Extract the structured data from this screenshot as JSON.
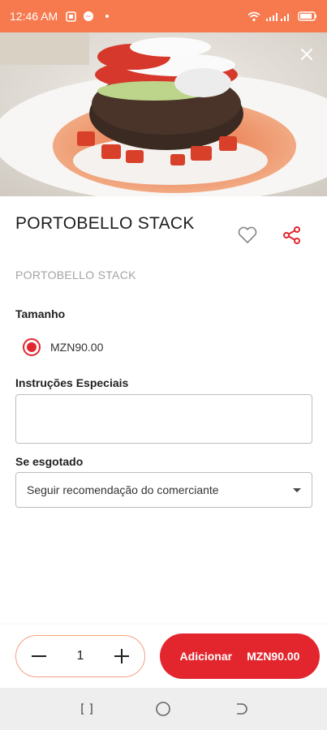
{
  "status_bar": {
    "time": "12:46 AM",
    "icons": [
      "sim-icon",
      "messenger-icon",
      "dot-icon",
      "wifi-icon",
      "signal-icon",
      "battery-icon"
    ]
  },
  "product": {
    "title": "PORTOBELLO STACK",
    "subtitle": "PORTOBELLO STACK"
  },
  "size_section": {
    "label": "Tamanho",
    "option_price": "MZN90.00"
  },
  "instructions_section": {
    "label": "Instruções Especiais",
    "value": ""
  },
  "sold_out_section": {
    "label": "Se esgotado",
    "selected": "Seguir recomendação do comerciante"
  },
  "cart": {
    "quantity": "1",
    "add_label": "Adicionar",
    "add_price": "MZN90.00"
  },
  "colors": {
    "status_bar": "#f77a4f",
    "accent": "#e3262e",
    "stepper_border": "#f1a27f"
  }
}
